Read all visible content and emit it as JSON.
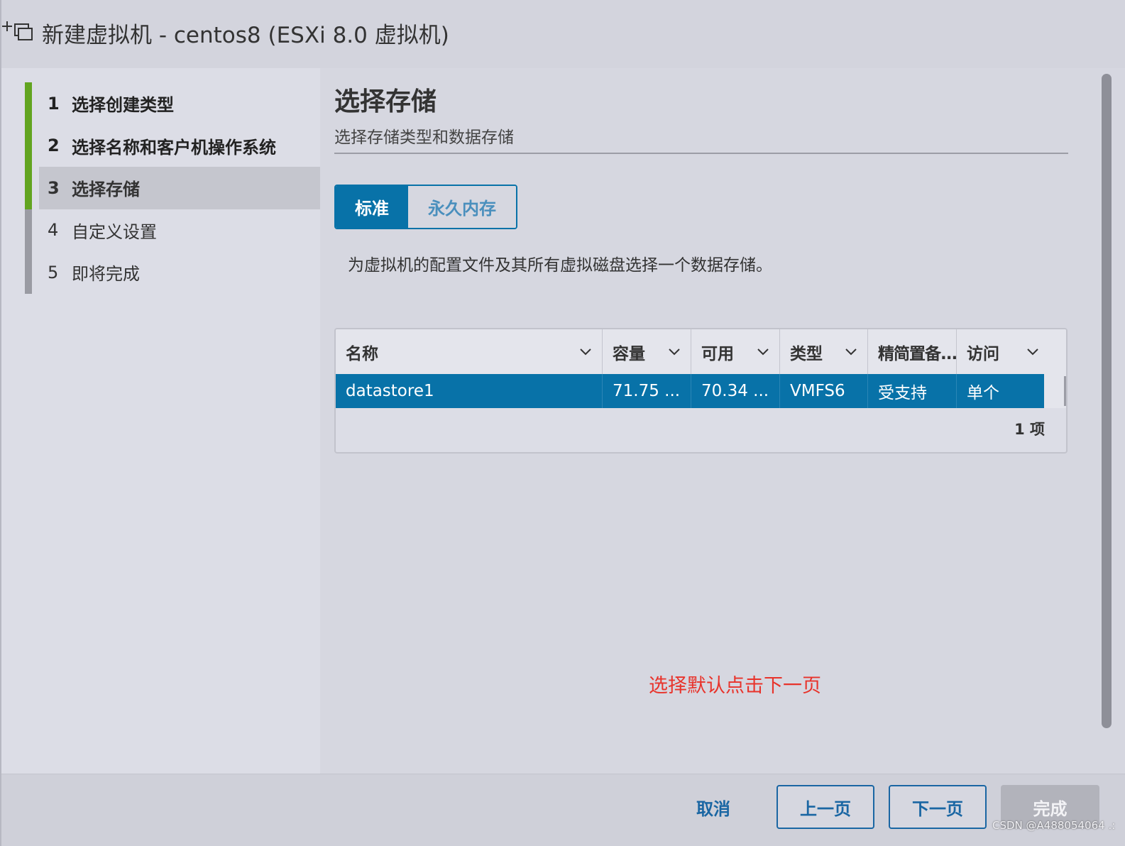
{
  "window": {
    "title": "新建虚拟机 - centos8 (ESXi 8.0 虚拟机)",
    "icon": "new-vm-icon"
  },
  "steps": [
    {
      "num": "1",
      "label": "选择创建类型",
      "state": "done"
    },
    {
      "num": "2",
      "label": "选择名称和客户机操作系统",
      "state": "done"
    },
    {
      "num": "3",
      "label": "选择存储",
      "state": "active"
    },
    {
      "num": "4",
      "label": "自定义设置",
      "state": "pending"
    },
    {
      "num": "5",
      "label": "即将完成",
      "state": "pending"
    }
  ],
  "main": {
    "title": "选择存储",
    "subtitle": "选择存储类型和数据存储",
    "tabs": [
      {
        "label": "标准",
        "selected": true
      },
      {
        "label": "永久内存",
        "selected": false
      }
    ],
    "description": "为虚拟机的配置文件及其所有虚拟磁盘选择一个数据存储。"
  },
  "table": {
    "columns": [
      "名称",
      "容量",
      "可用",
      "类型",
      "精简置备...",
      "访问"
    ],
    "rows": [
      [
        "datastore1",
        "71.75 ...",
        "70.34 ...",
        "VMFS6",
        "受支持",
        "单个"
      ]
    ],
    "footer": "1 项"
  },
  "annotation": "选择默认点击下一页",
  "buttons": {
    "cancel": "取消",
    "prev": "上一页",
    "next": "下一页",
    "finish": "完成"
  },
  "watermark": "CSDN @A488054064 .:",
  "colors": {
    "accent": "#0872a8",
    "step_done": "#62a420",
    "annotation": "#e8332b"
  }
}
